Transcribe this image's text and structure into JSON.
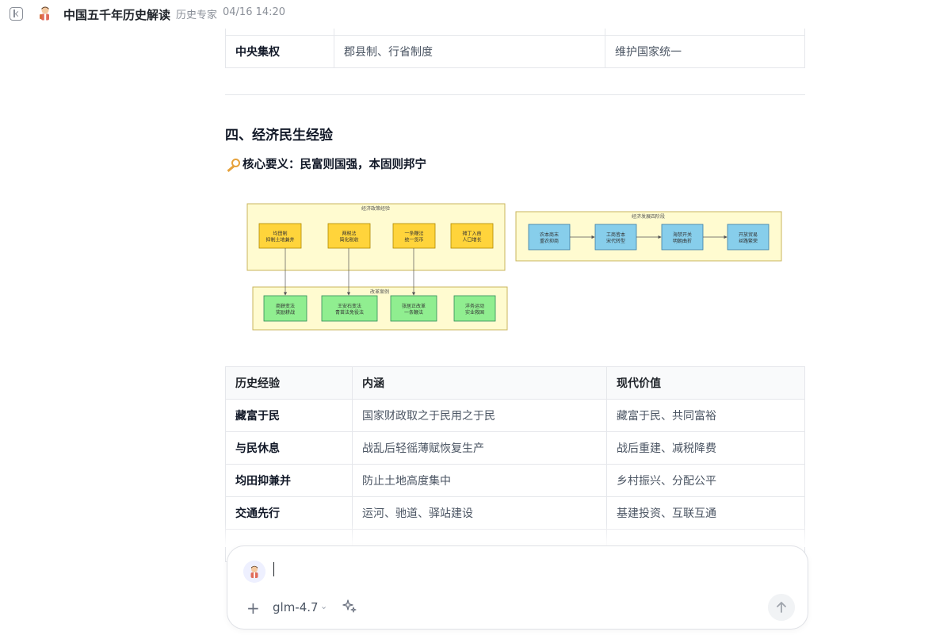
{
  "header": {
    "title": "中国五千年历史解读",
    "separator": "·",
    "role": "历史专家",
    "timestamp": "04/16 14:20"
  },
  "top_table": {
    "row": [
      "中央集权",
      "郡县制、行省制度",
      "维护国家统一"
    ]
  },
  "section": {
    "heading": "四、经济民生经验",
    "key_point": "核心要义：民富则国强，本固则邦宁"
  },
  "diagram": {
    "group1_title": "经济政策经验",
    "group1_nodes": [
      [
        "均田制",
        "抑制土地兼并"
      ],
      [
        "两税法",
        "简化税收"
      ],
      [
        "一条鞭法",
        "统一货币"
      ],
      [
        "摊丁入亩",
        "人口增长"
      ]
    ],
    "group2_title": "改革案例",
    "group2_nodes": [
      [
        "商鞅变法",
        "奖励耕战"
      ],
      [
        "王安石变法",
        "青苗法免役法"
      ],
      [
        "张居正改革",
        "一条鞭法"
      ],
      [
        "洋务运动",
        "实业救国"
      ]
    ],
    "group3_title": "经济发展四阶段",
    "group3_nodes": [
      [
        "农本商末",
        "重农抑商"
      ],
      [
        "工商皆本",
        "宋代转型"
      ],
      [
        "海禁开关",
        "明朝曲折"
      ],
      [
        "开放贸易",
        "丝路繁荣"
      ]
    ],
    "colors": {
      "group_fill": "#fffbd0",
      "group_stroke": "#c9b55c",
      "yellow_node": "#ffd43b",
      "yellow_stroke": "#b08800",
      "green_node": "#90ee90",
      "green_stroke": "#2e8b57",
      "blue_node": "#87ceeb",
      "blue_stroke": "#3a7ca5"
    }
  },
  "main_table": {
    "headers": [
      "历史经验",
      "内涵",
      "现代价值"
    ],
    "rows": [
      [
        "藏富于民",
        "国家财政取之于民用之于民",
        "藏富于民、共同富裕"
      ],
      [
        "与民休息",
        "战乱后轻徭薄赋恢复生产",
        "战后重建、减税降费"
      ],
      [
        "均田抑兼并",
        "防止土地高度集中",
        "乡村振兴、分配公平"
      ],
      [
        "交通先行",
        "运河、驰道、驿站建设",
        "基建投资、互联互通"
      ]
    ]
  },
  "composer": {
    "model": "glm-4.7",
    "plus": "+",
    "chevron": "⌄"
  }
}
